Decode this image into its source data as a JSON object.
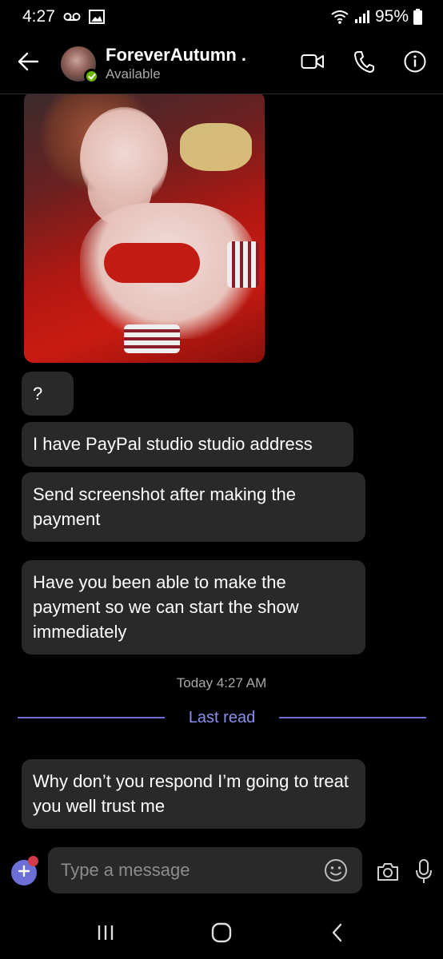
{
  "status_bar": {
    "time": "4:27",
    "battery": "95%"
  },
  "header": {
    "contact_name": "ForeverAutumn .",
    "status": "Available"
  },
  "messages": [
    {
      "text": "?"
    },
    {
      "text": "I have PayPal studio studio address"
    },
    {
      "text": "Send screenshot after making the payment"
    },
    {
      "text": "Have you been able to make the payment so we can start the show immediately"
    },
    {
      "text": "Why don’t you respond I’m going to treat you well trust me"
    }
  ],
  "timestamp": "Today 4:27 AM",
  "last_read_label": "Last read",
  "composer": {
    "placeholder": "Type a message"
  },
  "colors": {
    "accent": "#6b6fd6",
    "bubble": "#292929",
    "presence": "#6bb700",
    "badge": "#d33a4a"
  },
  "icons": {
    "back": "arrow-left-icon",
    "video": "video-camera-icon",
    "call": "phone-icon",
    "info": "info-icon",
    "add": "plus-icon",
    "emoji": "smiley-icon",
    "camera": "camera-icon",
    "mic": "microphone-icon"
  }
}
